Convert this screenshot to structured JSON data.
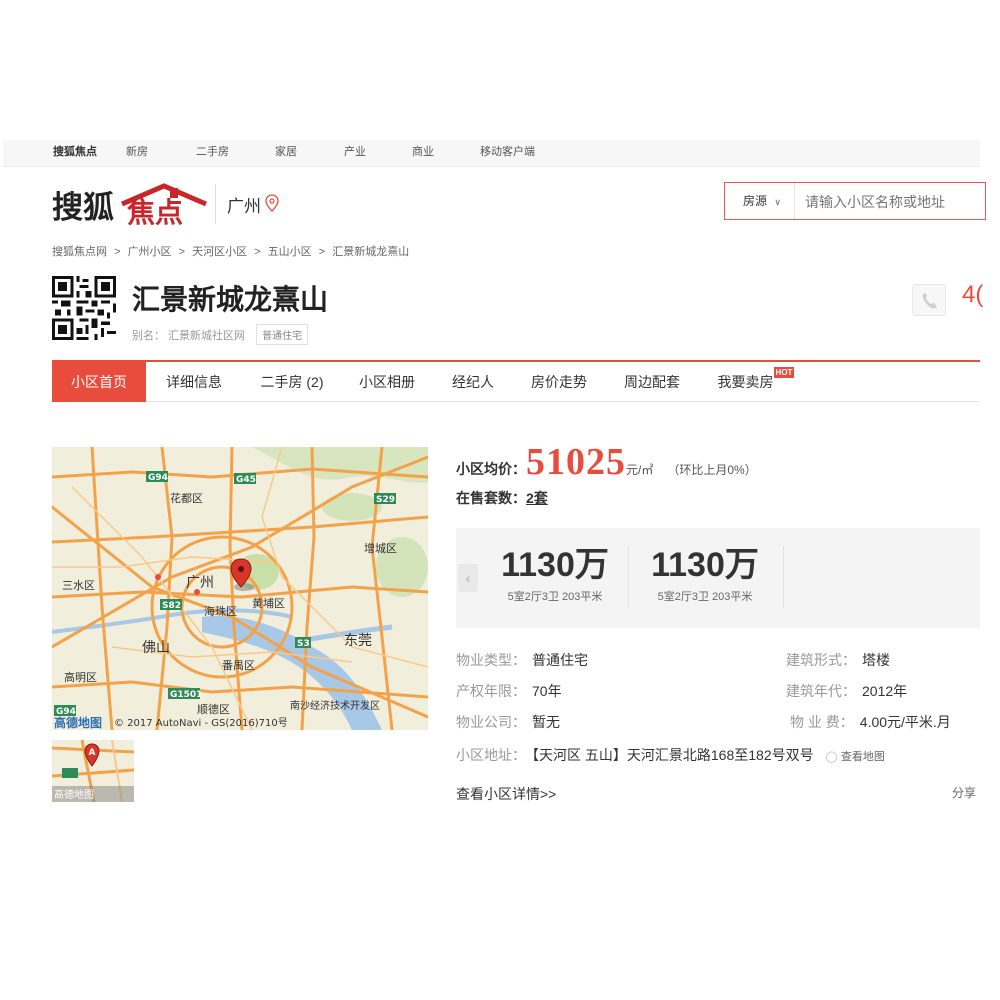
{
  "topnav": {
    "items": [
      "搜狐焦点",
      "新房",
      "二手房",
      "家居",
      "产业",
      "商业",
      "移动客户端"
    ]
  },
  "header": {
    "logo_text": "搜狐焦点",
    "city": "广州",
    "search": {
      "select_label": "房源",
      "placeholder": "请输入小区名称或地址"
    }
  },
  "breadcrumb": [
    "搜狐焦点网",
    "广州小区",
    "天河区小区",
    "五山小区",
    "汇景新城龙熹山"
  ],
  "breadcrumb_sep": ">",
  "community": {
    "title": "汇景新城龙熹山",
    "alias_label": "别名：",
    "alias": "汇景新城社区网",
    "tag": "普通住宅",
    "phone_partial": "4("
  },
  "tabs": [
    {
      "label": "小区首页",
      "active": true
    },
    {
      "label": "详细信息",
      "active": false
    },
    {
      "label": "二手房 (2)",
      "active": false
    },
    {
      "label": "小区相册",
      "active": false
    },
    {
      "label": "经纪人",
      "active": false
    },
    {
      "label": "房价走势",
      "active": false
    },
    {
      "label": "周边配套",
      "active": false
    },
    {
      "label": "我要卖房",
      "active": false
    }
  ],
  "hot_badge": "HOT",
  "map": {
    "labels": [
      "花都区",
      "增城区",
      "三水区",
      "广州",
      "黄埔区",
      "海珠区",
      "佛山",
      "东莞",
      "番禺区",
      "高明区",
      "顺德区",
      "南沙经济技术开发区"
    ],
    "road_labels": [
      "G94",
      "G45",
      "S29",
      "S82",
      "S3",
      "G1501",
      "G94"
    ],
    "copyright": "© 2017 AutoNavi - GS(2016)710号",
    "brand": "高德地图",
    "thumb_brand": "高德地图"
  },
  "price": {
    "label": "小区均价：",
    "value": "51025",
    "unit": "元/㎡",
    "change": "（环比上月0%）"
  },
  "sale": {
    "label": "在售套数：",
    "value": "2套"
  },
  "listings": [
    {
      "price": "1130万",
      "desc": "5室2厅3卫 203平米"
    },
    {
      "price": "1130万",
      "desc": "5室2厅3卫 203平米"
    }
  ],
  "carousel_prev": "‹",
  "info": {
    "type_label": "物业类型：",
    "type_value": "普通住宅",
    "build_form_label": "建筑形式：",
    "build_form_value": "塔楼",
    "term_label": "产权年限：",
    "term_value": "70年",
    "year_label": "建筑年代：",
    "year_value": "2012年",
    "company_label": "物业公司：",
    "company_value": "暂无",
    "fee_label": "物 业 费：",
    "fee_value": "4.00元/平米.月",
    "addr_label": "小区地址：",
    "addr_value": "【天河区 五山】天河汇景北路168至182号双号",
    "addr_map": "查看地图"
  },
  "detail_link": "查看小区详情>>",
  "share": "分享",
  "colors": {
    "accent": "#e84c3d",
    "map_road": "#f3a24a",
    "map_bg": "#f1eedc",
    "map_water": "#a8c8e8",
    "map_green": "#c8dfa8"
  }
}
